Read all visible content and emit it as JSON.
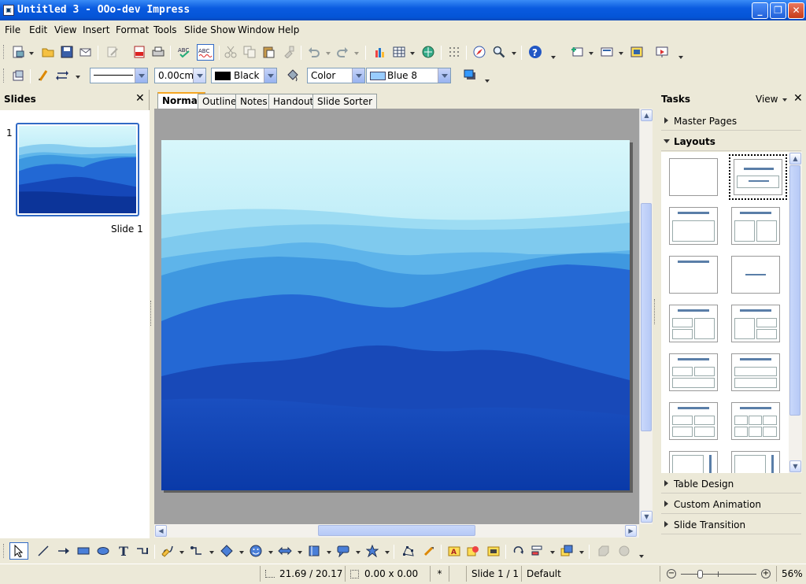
{
  "window": {
    "title": "Untitled 3 - OOo-dev Impress",
    "controls": [
      "minimize",
      "restore",
      "close"
    ]
  },
  "menu": [
    "File",
    "Edit",
    "View",
    "Insert",
    "Format",
    "Tools",
    "Slide Show",
    "Window",
    "Help"
  ],
  "line_toolbar": {
    "line_width": "0.00cm",
    "line_color": "Black",
    "area_style": "Color",
    "area_color": "Blue 8",
    "line_color_swatch": "#000000",
    "area_color_swatch": "#99ccff"
  },
  "slides_panel": {
    "title": "Slides",
    "slides": [
      {
        "number": "1",
        "label": "Slide 1"
      }
    ]
  },
  "view_tabs": [
    "Normal",
    "Outline",
    "Notes",
    "Handout",
    "Slide Sorter"
  ],
  "active_tab": "Normal",
  "tasks_panel": {
    "title": "Tasks",
    "view_label": "View",
    "sections": {
      "master_pages": "Master Pages",
      "layouts": "Layouts",
      "table_design": "Table Design",
      "custom_animation": "Custom Animation",
      "slide_transition": "Slide Transition"
    }
  },
  "status": {
    "position": "21.69 / 20.17",
    "size": "0.00 x 0.00",
    "modified": "*",
    "slide": "Slide 1 / 1",
    "master": "Default",
    "zoom": "56%"
  },
  "icons": {
    "standard_toolbar": [
      "new-icon",
      "open-icon",
      "save-icon",
      "email-icon",
      "edit-file-icon",
      "export-pdf-icon",
      "print-icon",
      "spellcheck-icon",
      "autospellcheck-icon",
      "cut-icon",
      "copy-icon",
      "paste-icon",
      "format-paintbrush-icon",
      "undo-icon",
      "redo-icon",
      "chart-icon",
      "table-icon",
      "hyperlink-icon",
      "grid-icon",
      "navigator-icon",
      "zoom-icon",
      "help-icon",
      "slide-icon",
      "slide-design-icon",
      "display-views-icon",
      "slide-show-icon"
    ],
    "drawing_toolbar": [
      "select-icon",
      "line-icon",
      "arrow-icon",
      "rectangle-icon",
      "ellipse-icon",
      "text-icon",
      "connector-icon",
      "curve-icon",
      "lines-arrows-icon",
      "basic-shapes-icon",
      "symbol-shapes-icon",
      "block-arrows-icon",
      "flowchart-icon",
      "callouts-icon",
      "stars-icon",
      "points-icon",
      "glue-points-icon",
      "fontwork-icon",
      "from-file-icon",
      "gallery-icon",
      "rotate-icon",
      "alignment-icon",
      "arrange-icon",
      "extrusion-icon",
      "3d-icon"
    ]
  },
  "colors": {
    "slide_sky": "#d8f6fb",
    "slide_deep": "#0a3aa8",
    "selection_border": "#316ac5"
  }
}
